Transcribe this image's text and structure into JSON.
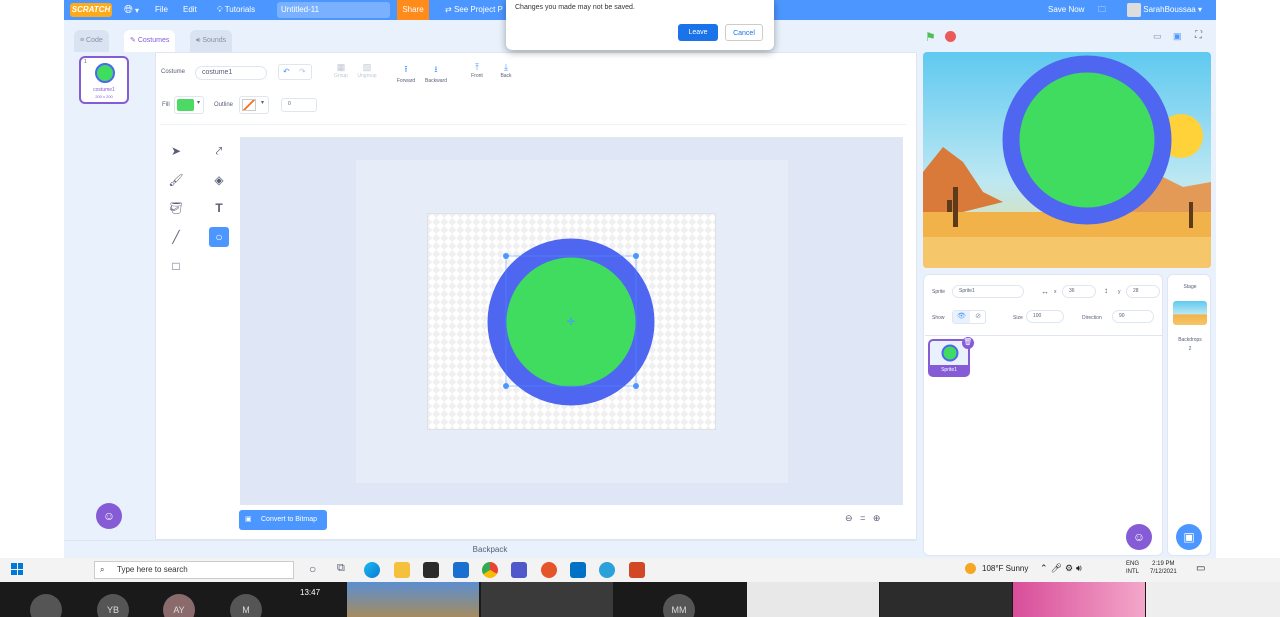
{
  "menu": {
    "logo": "SCRATCH",
    "file": "File",
    "edit": "Edit",
    "tutorials": "Tutorials",
    "project_title": "Untitled-11",
    "share": "Share",
    "see_project": "See Project P",
    "save_now": "Save Now",
    "username": "SarahBoussaa"
  },
  "dialog": {
    "message": "Changes you made may not be saved.",
    "leave": "Leave",
    "cancel": "Cancel"
  },
  "tabs": {
    "code": "Code",
    "costumes": "Costumes",
    "sounds": "Sounds"
  },
  "costume_list": [
    {
      "index": "1",
      "name": "costume1",
      "size": "200 x 200"
    }
  ],
  "paint": {
    "costume_label": "Costume",
    "costume_name": "costume1",
    "group": "Group",
    "ungroup": "Ungroup",
    "forward": "Forward",
    "backward": "Backward",
    "front": "Front",
    "back": "Back",
    "fill_label": "Fill",
    "outline_label": "Outline",
    "outline_width": "0",
    "convert": "Convert to Bitmap",
    "fill_color": "#4cd964",
    "circle_fill": "#40dc5f",
    "circle_outline": "#4f66f0"
  },
  "sprite": {
    "sprite_label": "Sprite",
    "sprite_name": "Sprite1",
    "x_label": "x",
    "x_value": "36",
    "y_label": "y",
    "y_value": "28",
    "show_label": "Show",
    "size_label": "Size",
    "size_value": "100",
    "direction_label": "Direction",
    "direction_value": "90",
    "tile_name": "Sprite1"
  },
  "stage_panel": {
    "title": "Stage",
    "backdrops_label": "Backdrops",
    "backdrops_count": "2"
  },
  "backpack": "Backpack",
  "taskbar": {
    "search_placeholder": "Type here to search",
    "weather": "108°F Sunny",
    "lang1": "ENG",
    "lang2": "INTL",
    "time": "2:19 PM",
    "date": "7/12/2021"
  },
  "video": {
    "time": "13:47",
    "participants": [
      "YB",
      "AY",
      "M",
      "MM"
    ]
  }
}
